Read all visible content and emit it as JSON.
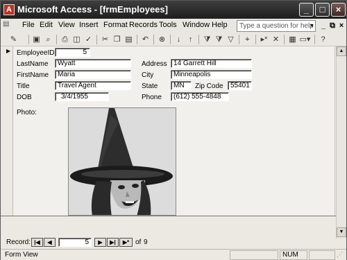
{
  "window": {
    "title": "Microsoft Access - [frmEmployees]"
  },
  "menu": {
    "items": [
      "File",
      "Edit",
      "View",
      "Insert",
      "Format",
      "Records",
      "Tools",
      "Window",
      "Help"
    ],
    "help_placeholder": "Type a question for help"
  },
  "form": {
    "labels": {
      "employee_id": "EmployeeID",
      "last_name": "LastName",
      "first_name": "FirstName",
      "title": "Title",
      "dob": "DOB",
      "address": "Address",
      "city": "City",
      "state": "State",
      "zip": "Zip Code",
      "phone": "Phone",
      "photo": "Photo:"
    },
    "values": {
      "employee_id": "5",
      "last_name": "Wyatt",
      "first_name": "Maria",
      "title": "Travel Agent",
      "dob": "3/4/1955",
      "address": "14 Garrett Hill",
      "city": "Minneapolis",
      "state": "MN",
      "zip": "55401",
      "phone": "(612) 555-4848"
    }
  },
  "navigation": {
    "label": "Record:",
    "current": "5",
    "of_label": "of",
    "total": "9"
  },
  "status": {
    "view": "Form View",
    "num": "NUM"
  }
}
